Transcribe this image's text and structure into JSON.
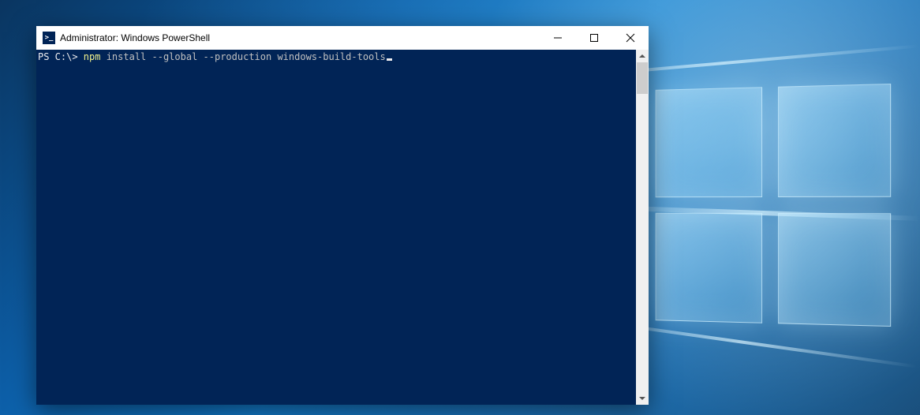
{
  "desktop": {
    "os": "Windows 10"
  },
  "window": {
    "icon_label": ">_",
    "title": "Administrator: Windows PowerShell",
    "controls": {
      "minimize": "Minimize",
      "maximize": "Maximize",
      "close": "Close"
    }
  },
  "terminal": {
    "prompt": "PS C:\\> ",
    "command_exe": "npm",
    "command_args": " install --global --production windows-build-tools",
    "colors": {
      "background": "#012456",
      "foreground": "#eeedf0",
      "command_highlight": "#f2f28c",
      "args": "#c0c0c0"
    }
  },
  "scrollbar": {
    "up": "Scroll up",
    "down": "Scroll down",
    "thumb": "Scroll thumb"
  }
}
